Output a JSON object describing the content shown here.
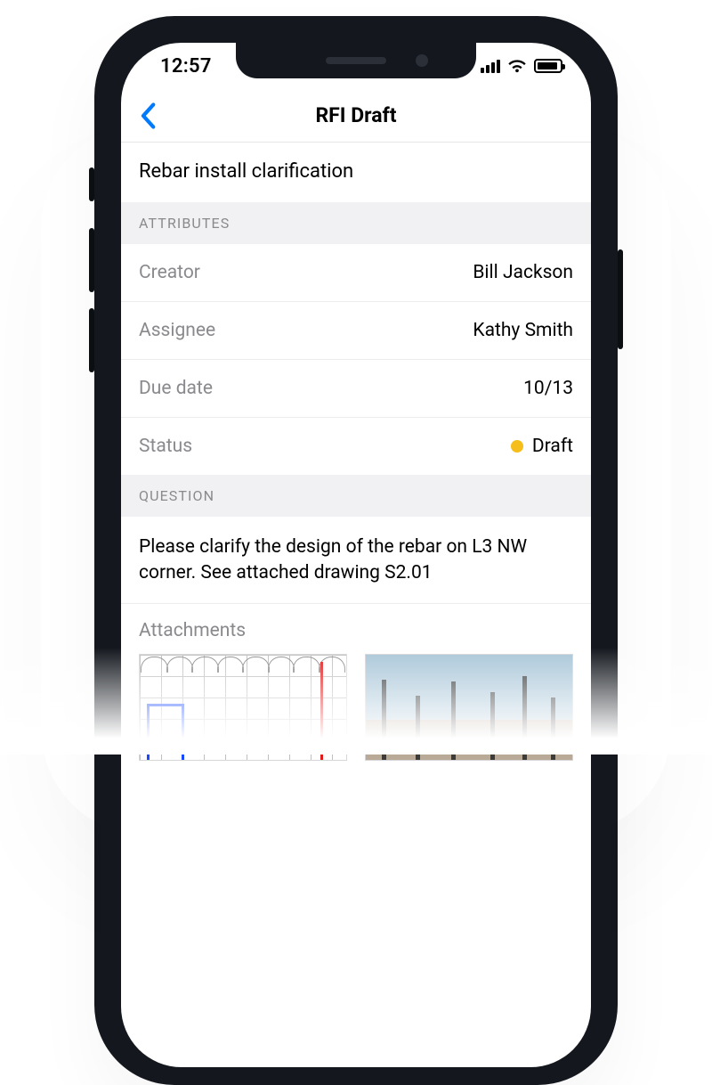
{
  "status_bar": {
    "time": "12:57"
  },
  "nav": {
    "title": "RFI Draft"
  },
  "rfi": {
    "title": "Rebar install clarification"
  },
  "sections": {
    "attributes_header": "Attributes",
    "question_header": "Question"
  },
  "attributes": {
    "creator_label": "Creator",
    "creator_value": "Bill Jackson",
    "assignee_label": "Assignee",
    "assignee_value": "Kathy Smith",
    "due_date_label": "Due date",
    "due_date_value": "10/13",
    "status_label": "Status",
    "status_value": "Draft",
    "status_color": "#f6be1a"
  },
  "question": {
    "body": "Please clarify the design of the rebar on L3 NW corner. See attached drawing S2.01"
  },
  "attachments": {
    "label": "Attachments"
  }
}
